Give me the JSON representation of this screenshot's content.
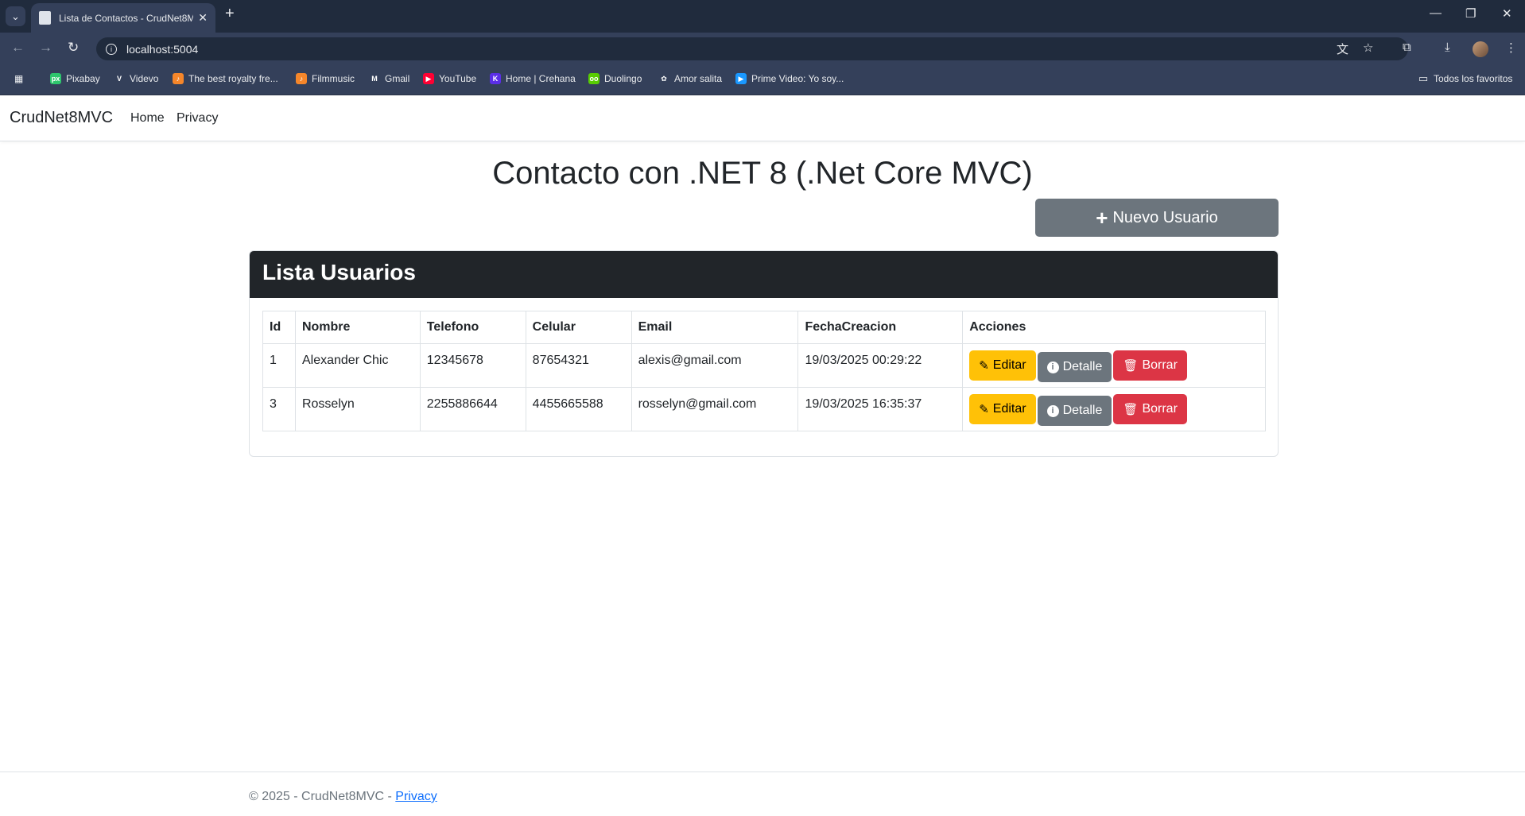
{
  "browser": {
    "tab_title": "Lista de Contactos - CrudNet8MVC",
    "url": "localhost:5004",
    "bookmarks": [
      {
        "label": "Pixabay",
        "icon": "pixabay-icon",
        "color": "#2ec66d",
        "glyph": "px"
      },
      {
        "label": "Videvo",
        "icon": "videvo-icon",
        "color": "#34405a",
        "glyph": "V"
      },
      {
        "label": "The best royalty fre...",
        "icon": "music-icon",
        "color": "#f5862a",
        "glyph": "♪"
      },
      {
        "label": "Filmmusic",
        "icon": "filmmusic-icon",
        "color": "#f5862a",
        "glyph": "♪"
      },
      {
        "label": "Gmail",
        "icon": "gmail-icon",
        "color": "#34405a",
        "glyph": "M"
      },
      {
        "label": "YouTube",
        "icon": "youtube-icon",
        "color": "#ff0033",
        "glyph": "▶"
      },
      {
        "label": "Home | Crehana",
        "icon": "crehana-icon",
        "color": "#5b2ee6",
        "glyph": "K"
      },
      {
        "label": "Duolingo",
        "icon": "duolingo-icon",
        "color": "#58cc02",
        "glyph": "oo"
      },
      {
        "label": "Amor salita",
        "icon": "photos-icon",
        "color": "#34405a",
        "glyph": "✿"
      },
      {
        "label": "Prime Video: Yo soy...",
        "icon": "primevideo-icon",
        "color": "#1a98ff",
        "glyph": "▶"
      }
    ],
    "all_bookmarks": "Todos los favoritos"
  },
  "nav": {
    "brand": "CrudNet8MVC",
    "links": [
      "Home",
      "Privacy"
    ]
  },
  "main": {
    "title": "Contacto con .NET 8 (.Net Core MVC)",
    "new_button": "Nuevo Usuario",
    "card_title": "Lista Usuarios",
    "columns": [
      "Id",
      "Nombre",
      "Telefono",
      "Celular",
      "Email",
      "FechaCreacion",
      "Acciones"
    ],
    "rows": [
      [
        "1",
        "Alexander Chic",
        "12345678",
        "87654321",
        "alexis@gmail.com",
        "19/03/2025 00:29:22"
      ],
      [
        "3",
        "Rosselyn",
        "2255886644",
        "4455665588",
        "rosselyn@gmail.com",
        "19/03/2025 16:35:37"
      ]
    ],
    "actions": {
      "edit": "Editar",
      "detail": "Detalle",
      "delete": "Borrar"
    }
  },
  "footer": {
    "text": "© 2025 - CrudNet8MVC - ",
    "link": "Privacy"
  }
}
